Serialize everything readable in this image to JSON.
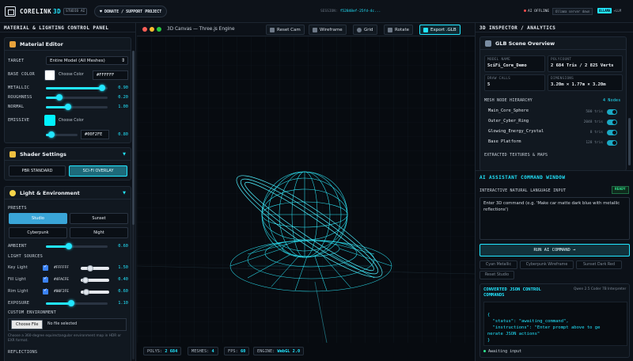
{
  "header": {
    "brand": "CORELINK",
    "version": "3D",
    "badge": "STUDIO AI",
    "donate_label": "DONATE / SUPPORT PROJECT",
    "session_label": "SESSION:",
    "session_id": "f52848ef-25fd-4c...",
    "ai_status": "AI OFFLINE",
    "ollama_status": "Ollama server down",
    "llm_mode_on": "OLLAMA",
    "llm_mode_alt": "+LLM"
  },
  "left_panel": {
    "title": "MATERIAL & LIGHTING CONTROL PANEL",
    "material_editor": {
      "title": "Material Editor",
      "target_label": "TARGET",
      "target_value": "Entire Model (All Meshes)",
      "base_color_label": "BASE COLOR",
      "base_color_choose": "Choose Color",
      "base_color_hex": "#FFFFFF",
      "metallic_label": "METALLIC",
      "metallic_value": "0.90",
      "roughness_label": "ROUGHNESS",
      "roughness_value": "0.20",
      "normal_label": "NORMAL",
      "normal_value": "1.00",
      "emissive_label": "EMISSIVE",
      "emissive_choose": "Choose Color",
      "emissive_hex": "#00F2FE",
      "emissive_value": "0.80"
    },
    "shader": {
      "title": "Shader Settings",
      "option_pbr": "PBR STANDARD",
      "option_scifi": "SCI-FI OVERLAY"
    },
    "light_env": {
      "title": "Light & Environment",
      "presets_label": "PRESETS",
      "presets": [
        "Studio",
        "Sunset",
        "Cyberpunk",
        "Night"
      ],
      "ambient_label": "AMBIENT",
      "ambient_value": "0.60",
      "light_sources_label": "LIGHT SOURCES",
      "lights": [
        {
          "name": "Key Light",
          "hex": "#FFFFFF",
          "value": "1.50"
        },
        {
          "name": "Fill Light",
          "hex": "#4FACFE",
          "value": "0.40"
        },
        {
          "name": "Rim Light",
          "hex": "#00F2FE",
          "value": "0.60"
        }
      ],
      "exposure_label": "EXPOSURE",
      "exposure_value": "1.10",
      "custom_env_label": "CUSTOM ENVIRONMENT",
      "choose_file": "Choose File",
      "no_file": "No file selected",
      "env_hint": "Choose a 360-degree equirectangular environment map in HDR or EXR format.",
      "reflections_label": "REFLECTIONS"
    }
  },
  "center": {
    "title": "3D Canvas — Three.js Engine",
    "tools": {
      "reset": "Reset Cam",
      "wireframe": "Wireframe",
      "grid": "Grid",
      "rotate": "Rotate",
      "export": "Export .GLB"
    },
    "stats": {
      "polys_label": "POLYS:",
      "polys": "2 684",
      "meshes_label": "MESHES:",
      "meshes": "4",
      "fps_label": "FPS:",
      "fps": "60",
      "engine_label": "ENGINE:",
      "engine": "WebGL 2.0"
    }
  },
  "right_panel": {
    "title": "3D INSPECTOR / ANALYTICS",
    "overview": {
      "title": "GLB Scene Overview",
      "model_name_label": "MODEL NAME",
      "model_name": "SciFi_Core_Demo",
      "polycount_label": "POLYCOUNT",
      "polycount": "2 684 Tris / 2 825 Verts",
      "draw_calls_label": "DRAW CALLS",
      "draw_calls": "5",
      "dimensions_label": "DIMENSIONS",
      "dimensions": "3.20m × 1.77m × 3.20m",
      "hierarchy_label": "MESH NODE HIERARCHY",
      "node_count": "4 Nodes",
      "nodes": [
        {
          "name": "Main_Core_Sphere",
          "tris": "500 tris"
        },
        {
          "name": "Outer_Cyber_Ring",
          "tris": "2048 tris"
        },
        {
          "name": "Glowing_Energy_Crystal",
          "tris": "8 tris"
        },
        {
          "name": "Base Platform",
          "tris": "128 tris"
        }
      ],
      "textures_label": "EXTRACTED TEXTURES & MAPS"
    },
    "assistant": {
      "title": "AI ASSISTANT COMMAND WINDOW",
      "input_label": "INTERACTIVE NATURAL LANGUAGE INPUT",
      "ready": "READY",
      "placeholder": "Enter 3D command (e.g. 'Make car matte dark blue with metallic reflections')",
      "run": "RUN AI COMMAND →",
      "chips": [
        "Cyan Metallic",
        "Cyberpunk Wireframe",
        "Sunset Dark Red",
        "Reset Studio"
      ],
      "json_title": "CONVERTED JSON CONTROL COMMANDS",
      "model_label": "Qwen 2.5 Coder 7B Interpreter",
      "json_lines": [
        "{",
        "  \"status\": \"awaiting_command\",",
        "  \"instructions\": \"Enter prompt above to ge",
        "nerate JSON actions\"",
        "}"
      ],
      "awaiting": "Awaiting input"
    }
  }
}
